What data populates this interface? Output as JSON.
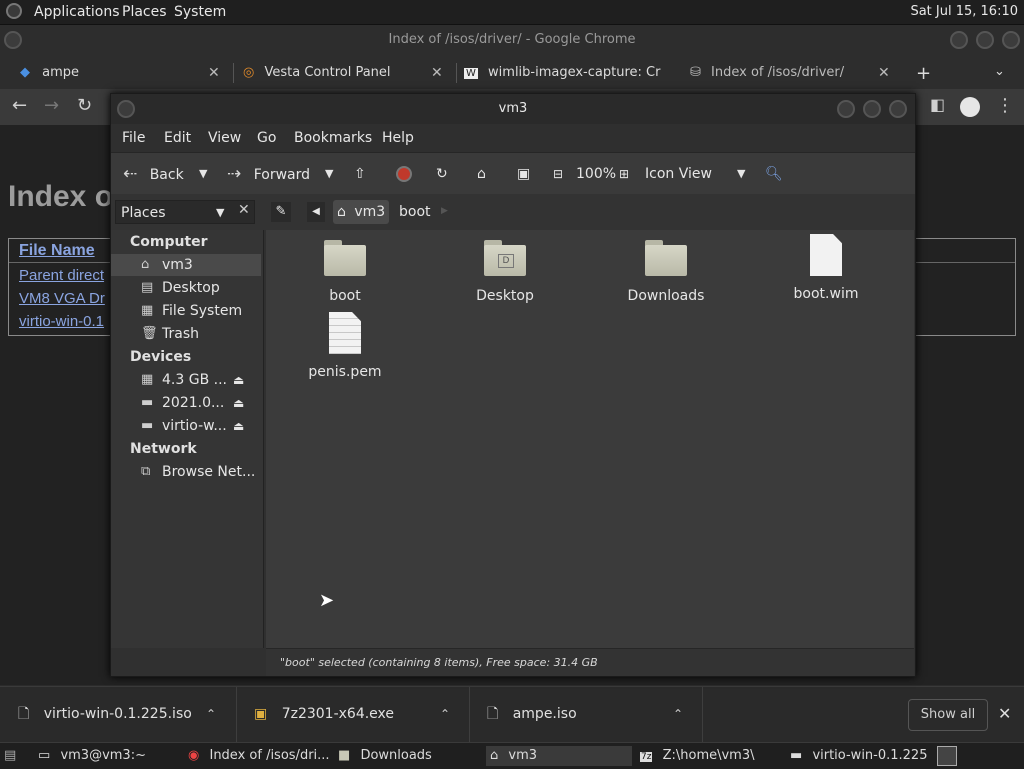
{
  "top_panel": {
    "menus": [
      "Applications",
      "Places",
      "System"
    ],
    "clock": "Sat Jul 15, 16:10"
  },
  "chrome": {
    "title": "Index of /isos/driver/ - Google Chrome",
    "tabs": [
      {
        "label": "ampe",
        "icon": "vm-logo-icon"
      },
      {
        "label": "Vesta Control Panel",
        "icon": "vesta-icon"
      },
      {
        "label": "wimlib-imagex-capture: Cr",
        "icon": "wiki-icon"
      },
      {
        "label": "Index of /isos/driver/",
        "icon": "page-icon"
      }
    ],
    "new_tab": "+",
    "page": {
      "heading": "Index o",
      "column_header": "File Name",
      "column_header_suffix": "↓",
      "links": [
        "Parent direct",
        "VM8 VGA Dr",
        "virtio-win-0.1"
      ]
    }
  },
  "downloads": {
    "items": [
      {
        "name": "virtio-win-0.1.225.iso"
      },
      {
        "name": "7z2301-x64.exe"
      },
      {
        "name": "ampe.iso"
      }
    ],
    "show_all": "Show all",
    "close": "✕"
  },
  "taskbar": {
    "items": [
      {
        "label": "vm3@vm3:~",
        "icon": "terminal-icon"
      },
      {
        "label": "Index of /isos/dri...",
        "icon": "chrome-icon"
      },
      {
        "label": "Downloads",
        "icon": "folder-icon"
      },
      {
        "label": "vm3",
        "icon": "home-folder-icon",
        "active": true
      },
      {
        "label": "Z:\\home\\vm3\\",
        "icon": "7z-icon"
      },
      {
        "label": "virtio-win-0.1.225",
        "icon": "drive-icon"
      }
    ]
  },
  "caja": {
    "title": "vm3",
    "menu": [
      "File",
      "Edit",
      "View",
      "Go",
      "Bookmarks",
      "Help"
    ],
    "toolbar": {
      "back": "Back",
      "forward": "Forward",
      "zoom": "100%",
      "view_mode": "Icon View"
    },
    "places_label": "Places",
    "breadcrumbs": [
      "vm3",
      "boot"
    ],
    "sidebar": {
      "computer_header": "Computer",
      "computer": [
        "vm3",
        "Desktop",
        "File System",
        "Trash"
      ],
      "devices_header": "Devices",
      "devices": [
        "4.3 GB ...",
        "2021.0...",
        "virtio-w..."
      ],
      "network_header": "Network",
      "network": [
        "Browse Net..."
      ]
    },
    "files": [
      {
        "name": "boot",
        "kind": "folder"
      },
      {
        "name": "Desktop",
        "kind": "folder"
      },
      {
        "name": "Downloads",
        "kind": "folder"
      },
      {
        "name": "boot.wim",
        "kind": "file"
      },
      {
        "name": "penis.pem",
        "kind": "text-file"
      }
    ],
    "status": "\"boot\" selected (containing 8 items), Free space: 31.4 GB"
  }
}
